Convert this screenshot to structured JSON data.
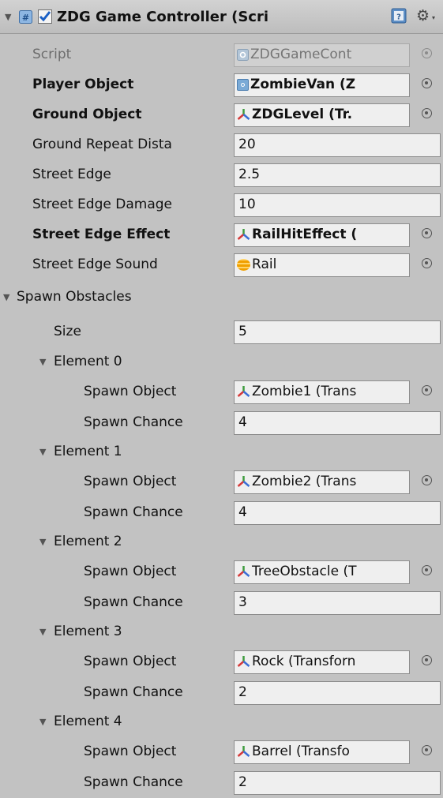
{
  "component": {
    "title": "ZDG Game Controller (Scri",
    "enabled": true
  },
  "properties": {
    "script": {
      "label": "Script",
      "value": "ZDGGameCont"
    },
    "player_object": {
      "label": "Player Object",
      "value": "ZombieVan (Z"
    },
    "ground_object": {
      "label": "Ground Object",
      "value": "ZDGLevel (Tr."
    },
    "ground_repeat_distance": {
      "label": "Ground Repeat Dista",
      "value": "20"
    },
    "street_edge": {
      "label": "Street Edge",
      "value": "2.5"
    },
    "street_edge_damage": {
      "label": "Street Edge Damage",
      "value": "10"
    },
    "street_edge_effect": {
      "label": "Street Edge Effect",
      "value": "RailHitEffect ("
    },
    "street_edge_sound": {
      "label": "Street Edge Sound",
      "value": "Rail"
    }
  },
  "spawn_obstacles": {
    "label": "Spawn Obstacles",
    "size_label": "Size",
    "size": "5",
    "spawn_object_label": "Spawn Object",
    "spawn_chance_label": "Spawn Chance",
    "elements": [
      {
        "label": "Element 0",
        "object": "Zombie1 (Trans",
        "chance": "4"
      },
      {
        "label": "Element 1",
        "object": "Zombie2 (Trans",
        "chance": "4"
      },
      {
        "label": "Element 2",
        "object": "TreeObstacle (T",
        "chance": "3"
      },
      {
        "label": "Element 3",
        "object": "Rock (Transforn",
        "chance": "2"
      },
      {
        "label": "Element 4",
        "object": "Barrel (Transfo",
        "chance": "2"
      }
    ]
  },
  "icons": {
    "foldout": "triangle-down-icon",
    "component": "script-component-icon",
    "help": "help-book-icon",
    "settings": "gear-icon",
    "transform": "transform-axes-icon",
    "audio": "audio-clip-icon",
    "object_picker": "object-picker-icon"
  },
  "colors": {
    "background": "#c2c2c2",
    "field": "#efefef",
    "checkbox_check": "#1a5fc4",
    "transform_x": "#d63b3b",
    "transform_y": "#3f9c3f",
    "transform_z": "#3b6fd6"
  }
}
